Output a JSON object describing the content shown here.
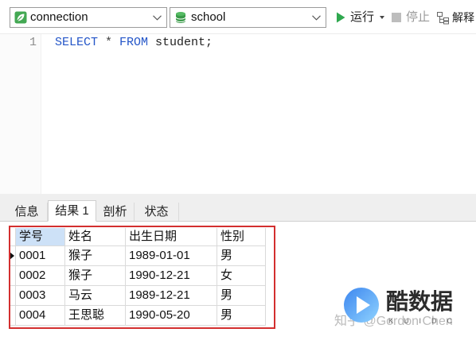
{
  "toolbar": {
    "connection_select": {
      "value": "connection",
      "icon": "connection-icon"
    },
    "database_select": {
      "value": "school",
      "icon": "database-icon"
    },
    "run": {
      "label": "运行",
      "icon": "run-icon"
    },
    "stop": {
      "label": "停止",
      "icon": "stop-icon",
      "enabled": false
    },
    "explain": {
      "label": "解释",
      "icon": "explain-icon"
    }
  },
  "editor": {
    "lines": [
      {
        "number": "1",
        "tokens": [
          {
            "text": "SELECT",
            "color": "#2456c8"
          },
          {
            "text": " * ",
            "color": "#444444"
          },
          {
            "text": "FROM",
            "color": "#2456c8"
          },
          {
            "text": " student;",
            "color": "#222222"
          }
        ]
      }
    ]
  },
  "result_tabs": [
    {
      "label": "信息",
      "active": false
    },
    {
      "label": "结果 1",
      "active": true
    },
    {
      "label": "剖析",
      "active": false
    },
    {
      "label": "状态",
      "active": false
    }
  ],
  "grid": {
    "columns": [
      "学号",
      "姓名",
      "出生日期",
      "性别"
    ],
    "rows": [
      [
        "0001",
        "猴子",
        "1989-01-01",
        "男"
      ],
      [
        "0002",
        "猴子",
        "1990-12-21",
        "女"
      ],
      [
        "0003",
        "马云",
        "1989-12-21",
        "男"
      ],
      [
        "0004",
        "王思聪",
        "1990-05-20",
        "男"
      ]
    ],
    "current_row_index": 0,
    "selected_column_index": 0
  },
  "annotation": {
    "color": "#d32f2f"
  },
  "watermark": {
    "brand": "酷数据",
    "brand_sub": "KUIDC",
    "credit": "知乎 @Gordon Chen"
  },
  "colors": {
    "accent_green": "#2fa84f",
    "selected_header": "#cde1f7"
  }
}
